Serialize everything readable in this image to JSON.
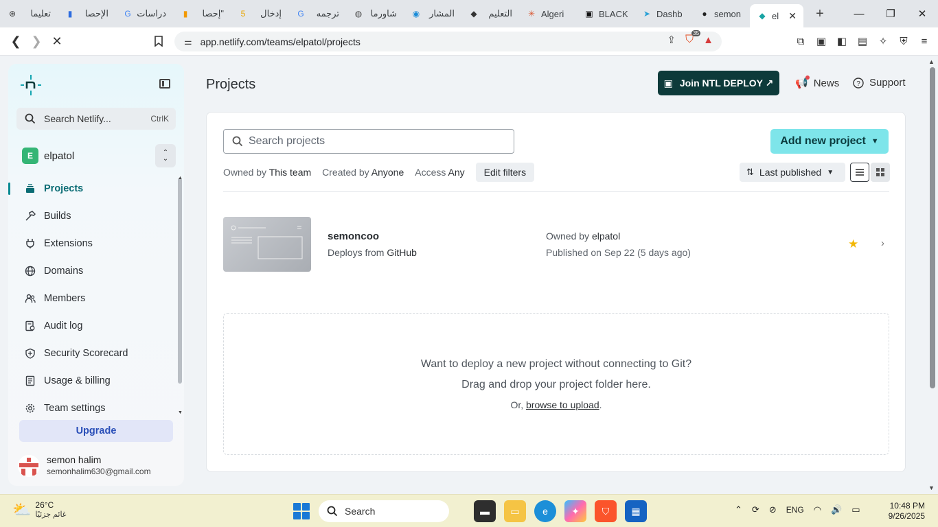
{
  "browser": {
    "tabs": [
      {
        "title": "تعليما",
        "icon": "openai-icon"
      },
      {
        "title": "الإحصا",
        "icon": "chart-icon"
      },
      {
        "title": "دراسات",
        "icon": "google-icon"
      },
      {
        "title": "\"إحصا",
        "icon": "analytics-icon"
      },
      {
        "title": "إدخال",
        "icon": "number-icon"
      },
      {
        "title": "ترجمه",
        "icon": "google-icon"
      },
      {
        "title": "شاورما",
        "icon": "globe-icon"
      },
      {
        "title": "المشار",
        "icon": "circle-icon"
      },
      {
        "title": "التعليم",
        "icon": "user-icon"
      },
      {
        "title": "Algeri",
        "icon": "spark-icon"
      },
      {
        "title": "BLACK",
        "icon": "box-icon"
      },
      {
        "title": "Dashb",
        "icon": "arrow-icon"
      },
      {
        "title": "semon",
        "icon": "github-icon"
      }
    ],
    "active_tab": {
      "title": "el",
      "icon": "netlify-icon"
    },
    "url": "app.netlify.com/teams/elpatol/projects",
    "shield_count": "35"
  },
  "sidebar": {
    "search_placeholder": "Search Netlify...",
    "search_shortcut": "CtrlK",
    "team_initial": "E",
    "team_name": "elpatol",
    "items": [
      {
        "label": "Projects",
        "icon": "layers-icon"
      },
      {
        "label": "Builds",
        "icon": "hammer-icon"
      },
      {
        "label": "Extensions",
        "icon": "plug-icon"
      },
      {
        "label": "Domains",
        "icon": "globe-icon"
      },
      {
        "label": "Members",
        "icon": "people-icon"
      },
      {
        "label": "Audit log",
        "icon": "log-icon"
      },
      {
        "label": "Security Scorecard",
        "icon": "shield-icon"
      },
      {
        "label": "Usage & billing",
        "icon": "receipt-icon"
      },
      {
        "label": "Team settings",
        "icon": "gear-icon"
      }
    ],
    "upgrade_label": "Upgrade",
    "user_name": "semon halim",
    "user_email": "semonhalim630@gmail.com"
  },
  "header": {
    "title": "Projects",
    "join_label": "Join NTL DEPLOY ↗",
    "news_label": "News",
    "support_label": "Support"
  },
  "projects": {
    "search_placeholder": "Search projects",
    "add_new_label": "Add new project",
    "filters": {
      "owned_label": "Owned by",
      "owned_value": "This team",
      "created_label": "Created by",
      "created_value": "Anyone",
      "access_label": "Access",
      "access_value": "Any",
      "edit_label": "Edit filters"
    },
    "sort_label": "Last published",
    "list": [
      {
        "name": "semoncoo",
        "deploys_prefix": "Deploys from",
        "deploys_source": "GitHub",
        "owner_prefix": "Owned by",
        "owner": "elpatol",
        "published": "Published on Sep 22 (5 days ago)",
        "starred": true
      }
    ],
    "dropzone": {
      "line1": "Want to deploy a new project without connecting to Git?",
      "line2": "Drag and drop your project folder here.",
      "prefix": "Or,",
      "link": "browse to upload",
      "suffix": "."
    }
  },
  "taskbar": {
    "temp": "26°C",
    "weather_text": "غائم جزئيًا",
    "search_label": "Search",
    "lang": "ENG",
    "time": "10:48 PM",
    "date": "9/26/2025"
  },
  "colors": {
    "accent": "#0a6c74",
    "join_bg": "#0d3a3a",
    "add_new_bg": "#7ee5ea",
    "star": "#f2b705"
  }
}
